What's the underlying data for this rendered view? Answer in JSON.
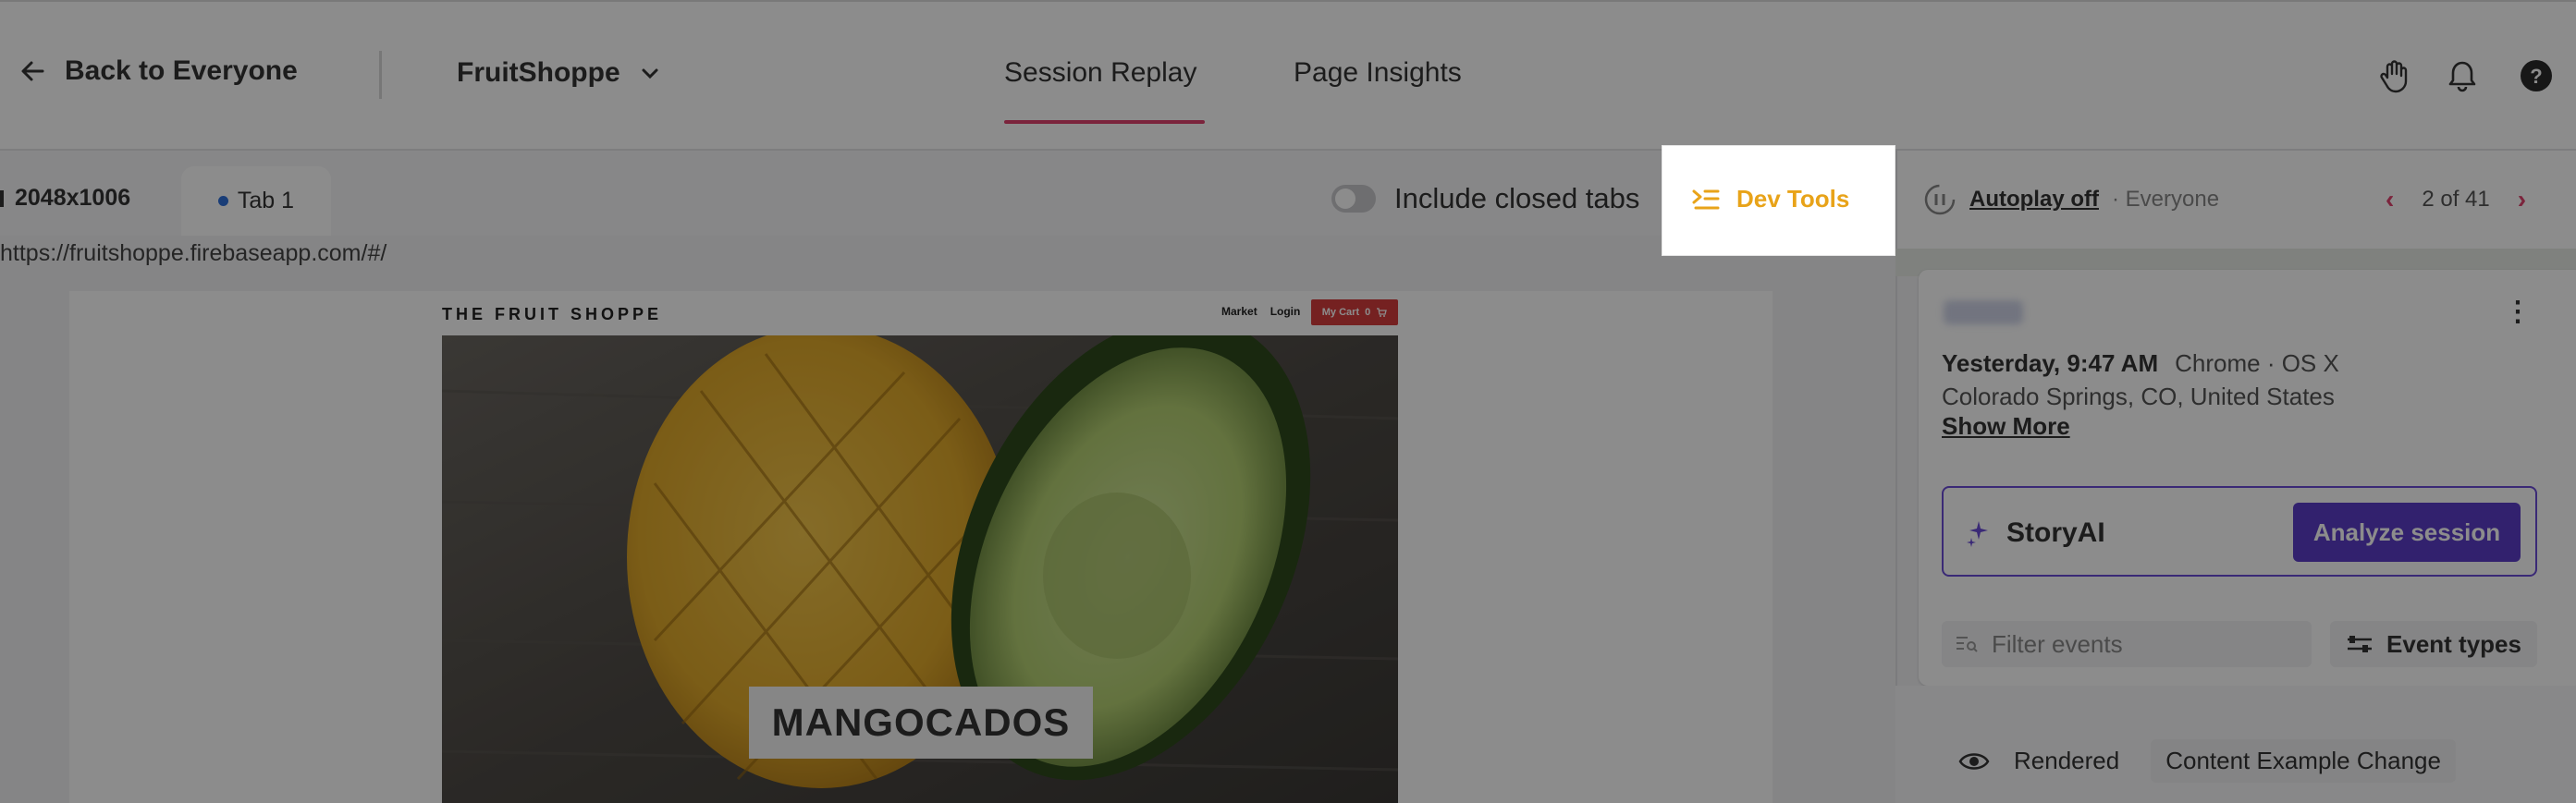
{
  "header": {
    "back_label": "Back to Everyone",
    "org_name": "FruitShoppe",
    "tabs": [
      {
        "label": "Session Replay",
        "active": true
      },
      {
        "label": "Page Insights",
        "active": false
      }
    ],
    "icons": [
      "hand-icon",
      "bell-icon",
      "help-icon"
    ]
  },
  "subbar": {
    "resolution": "2048x1006",
    "tab_label": "Tab 1",
    "include_closed_tabs": "Include closed tabs",
    "dev_tools": "Dev Tools",
    "url": "https://fruitshoppe.firebaseapp.com/#/"
  },
  "replay": {
    "site_title": "THE FRUIT SHOPPE",
    "nav": [
      "Market",
      "Login"
    ],
    "cart_label": "My Cart",
    "cart_count": "0",
    "hero_text": "MANGOCADOS"
  },
  "panel": {
    "autoplay_label": "Autoplay off",
    "autoplay_segment": "· Everyone",
    "pager": {
      "current": "2",
      "of": "of",
      "total": "41"
    },
    "session_time": "Yesterday, 9:47 AM",
    "browser_os": "Chrome · OS X",
    "location": "Colorado Springs, CO, United States",
    "show_more": "Show More",
    "storyai_label": "StoryAI",
    "analyze_button": "Analyze session",
    "filter_placeholder": "Filter events",
    "event_types": "Event types",
    "event": {
      "type": "Rendered",
      "detail": "Content Example Change"
    }
  },
  "colors": {
    "accent": "#e0426d",
    "devtools": "#e8a319",
    "storyai": "#5b3dc9",
    "cart": "#d63d3d"
  }
}
